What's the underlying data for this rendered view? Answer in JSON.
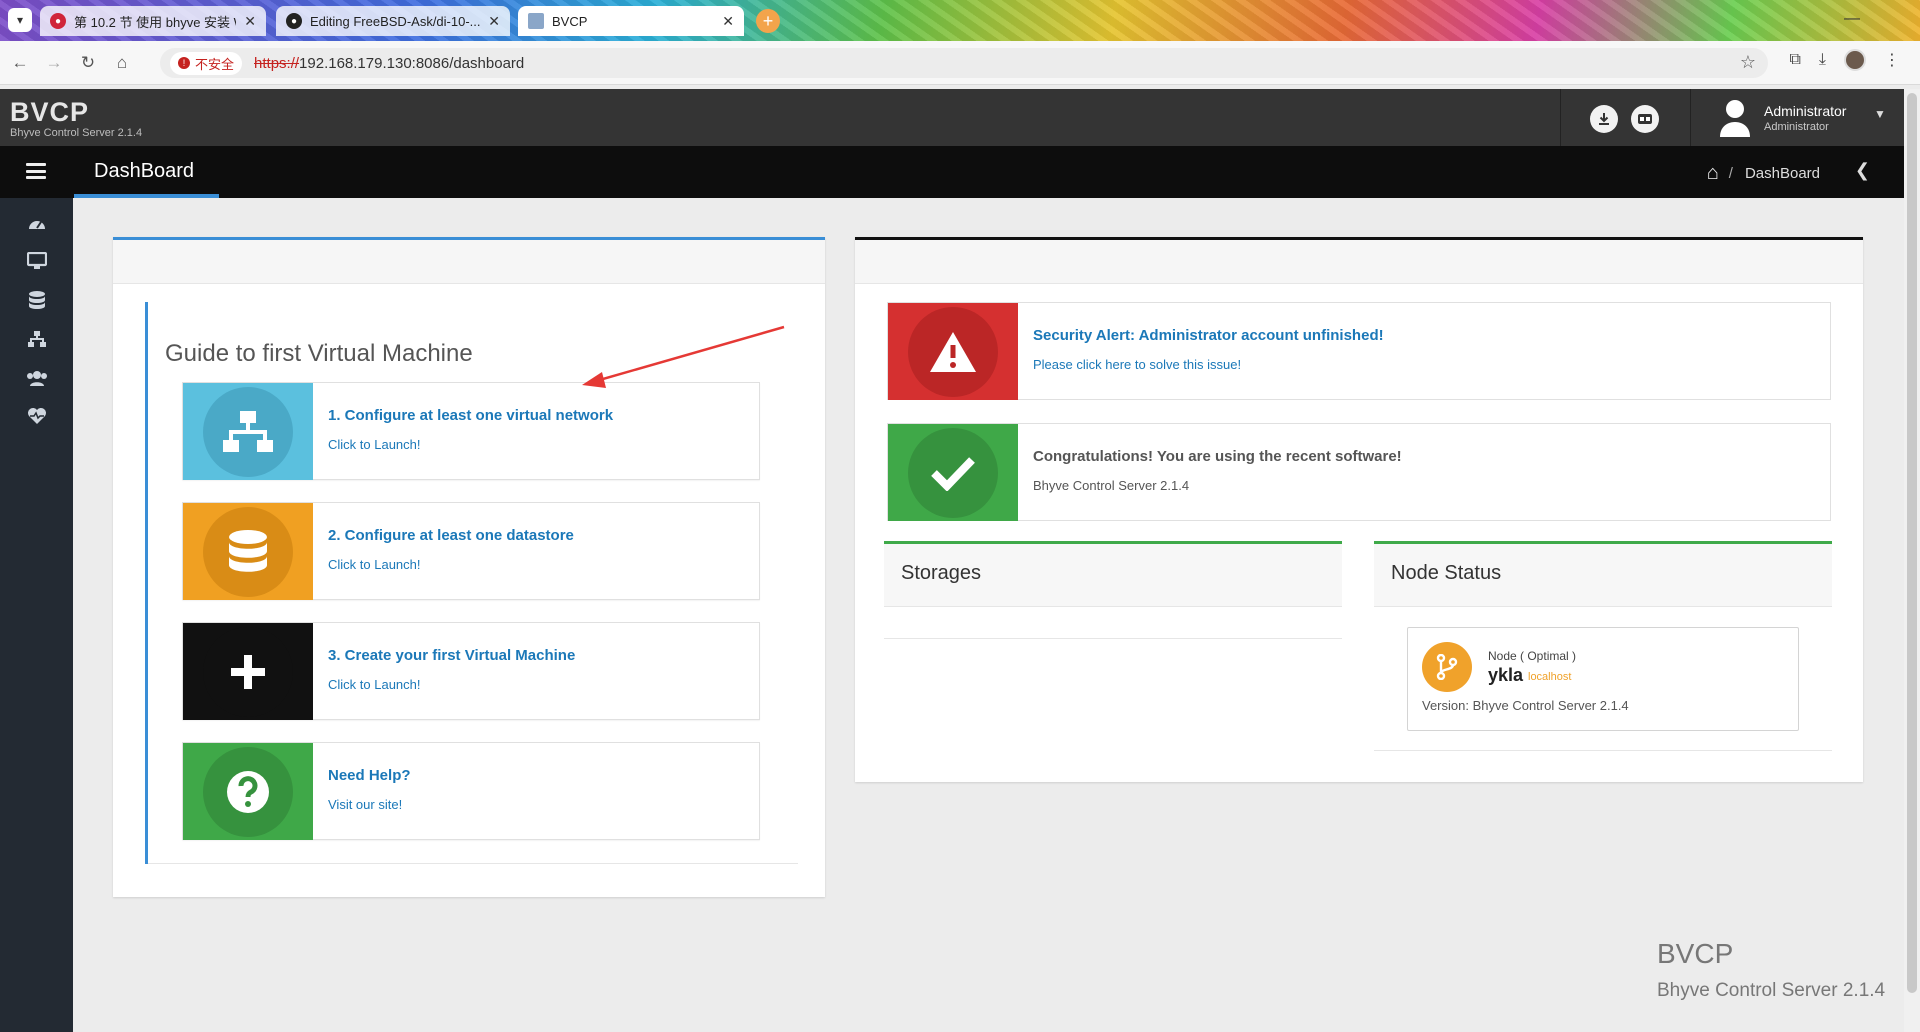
{
  "browser": {
    "tabs": [
      {
        "title": "第 10.2 节 使用 bhyve 安装 W",
        "active": false
      },
      {
        "title": "Editing FreeBSD-Ask/di-10-...",
        "active": false
      },
      {
        "title": "BVCP",
        "active": true
      }
    ],
    "insecure_label": "不安全",
    "url_scheme": "https://",
    "url_rest": "192.168.179.130:8086/dashboard"
  },
  "app": {
    "logo_title": "BVCP",
    "logo_sub": "Bhyve Control Server 2.1.4",
    "user_name": "Administrator",
    "user_role": "Administrator",
    "page_title": "DashBoard",
    "breadcrumb_current": "DashBoard",
    "breadcrumb_sep": "/"
  },
  "guide": {
    "title": "Guide to first Virtual Machine",
    "cards": [
      {
        "title": "1. Configure at least one virtual network",
        "sub": "Click to Launch!",
        "color": "#5bc0de"
      },
      {
        "title": "2. Configure at least one datastore",
        "sub": "Click to Launch!",
        "color": "#f0a022"
      },
      {
        "title": "3. Create your first Virtual Machine",
        "sub": "Click to Launch!",
        "color": "#111111"
      },
      {
        "title": "Need Help?",
        "sub": "Visit our site!",
        "color": "#3fa848"
      }
    ]
  },
  "alerts": [
    {
      "title": "Security Alert: Administrator account unfinished!",
      "sub": "Please click here to solve this issue!",
      "color": "#d53030"
    },
    {
      "title": "Congratulations! You are using the recent software!",
      "sub": "Bhyve Control Server 2.1.4",
      "color": "#3fa848"
    }
  ],
  "storages": {
    "title": "Storages"
  },
  "node_status": {
    "title": "Node Status",
    "status": "Node ( Optimal )",
    "name": "ykla",
    "host": "localhost",
    "version": "Version: Bhyve Control Server 2.1.4"
  },
  "footer": {
    "title": "BVCP",
    "sub": "Bhyve Control Server 2.1.4"
  },
  "colors": {
    "accent": "#3a8ed6",
    "link": "#1b78b8",
    "header": "#343434",
    "sidebar": "#232a33"
  }
}
